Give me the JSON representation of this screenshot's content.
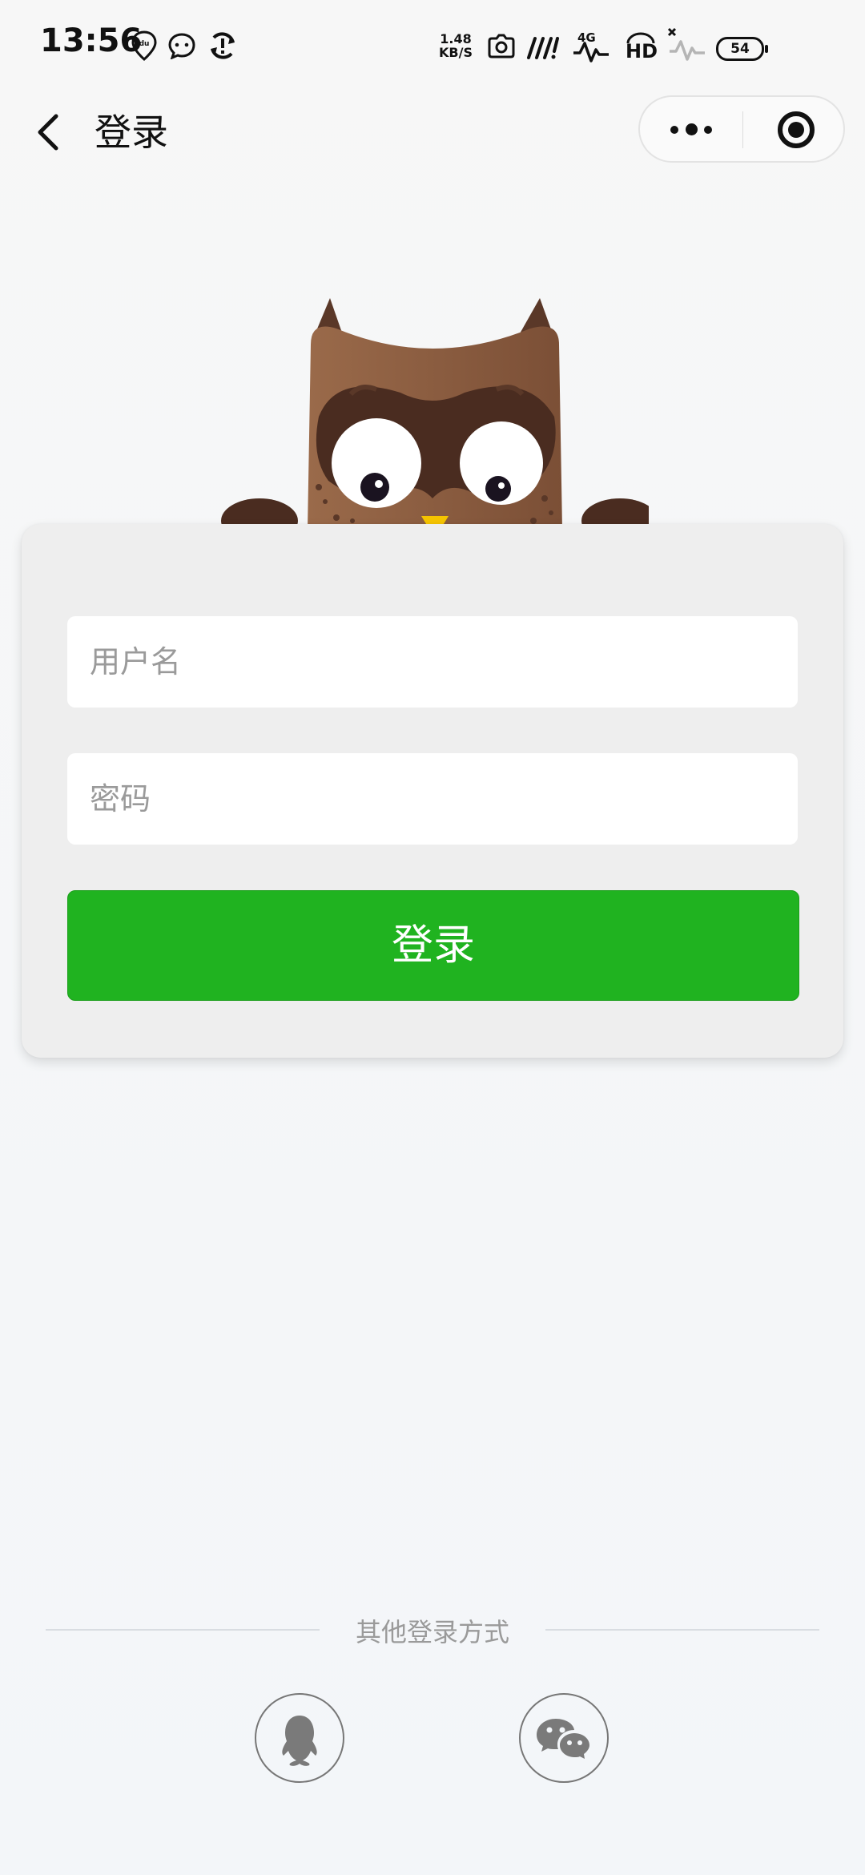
{
  "status_bar": {
    "time": "13:56",
    "net_speed_value": "1.48",
    "net_speed_unit": "KB/S",
    "signal_label": "4G",
    "hd_label": "HD",
    "battery": "54",
    "icons": [
      "baidu-location-icon",
      "chat-bubble-icon",
      "sync-alert-icon",
      "camera-icon",
      "wifi-icon",
      "mobile-signal-icon",
      "hd-voice-icon",
      "no-signal-icon",
      "battery-icon"
    ]
  },
  "nav": {
    "title": "登录",
    "back_icon": "chevron-left-icon",
    "more_icon": "more-dots-icon",
    "close_icon": "target-close-icon"
  },
  "form": {
    "username_placeholder": "用户名",
    "password_placeholder": "密码",
    "login_label": "登录"
  },
  "other_login": {
    "label": "其他登录方式",
    "options": [
      "qq-penguin-icon",
      "wechat-icon"
    ]
  },
  "colors": {
    "primary_green": "#20b320",
    "owl_brown": "#8a5a3e",
    "owl_dark": "#4a2c20",
    "beak": "#f5c400"
  }
}
